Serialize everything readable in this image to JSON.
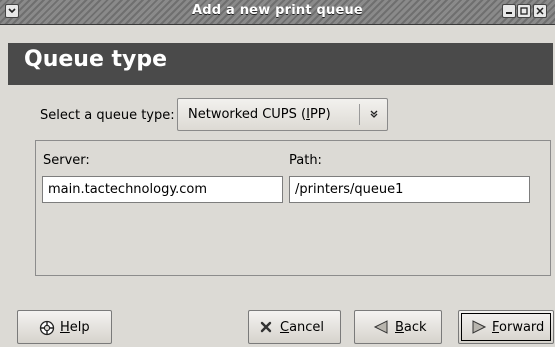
{
  "window": {
    "title": "Add a new print queue"
  },
  "header": {
    "title": "Queue type"
  },
  "queue_type": {
    "label": "Select a queue type:",
    "selected_before": "Networked CUPS (",
    "selected_mnemonic": "I",
    "selected_after": "PP)"
  },
  "server": {
    "label": "Server:",
    "value": "main.tactechnology.com"
  },
  "path": {
    "label": "Path:",
    "value": "/printers/queue1"
  },
  "buttons": {
    "help": {
      "mnemonic": "H",
      "rest": "elp"
    },
    "cancel": {
      "mnemonic": "C",
      "rest": "ancel"
    },
    "back": {
      "mnemonic": "B",
      "rest": "ack"
    },
    "forward": {
      "mnemonic": "F",
      "rest": "orward"
    }
  },
  "icons": {
    "window_menu": "chevron-down-icon",
    "minimize": "minimize-icon",
    "maximize": "maximize-icon",
    "close": "close-icon",
    "help": "help-lifebuoy-icon",
    "cancel": "cancel-x-icon",
    "back": "arrow-left-icon",
    "forward": "arrow-right-icon",
    "combo": "chevron-down-icon"
  }
}
